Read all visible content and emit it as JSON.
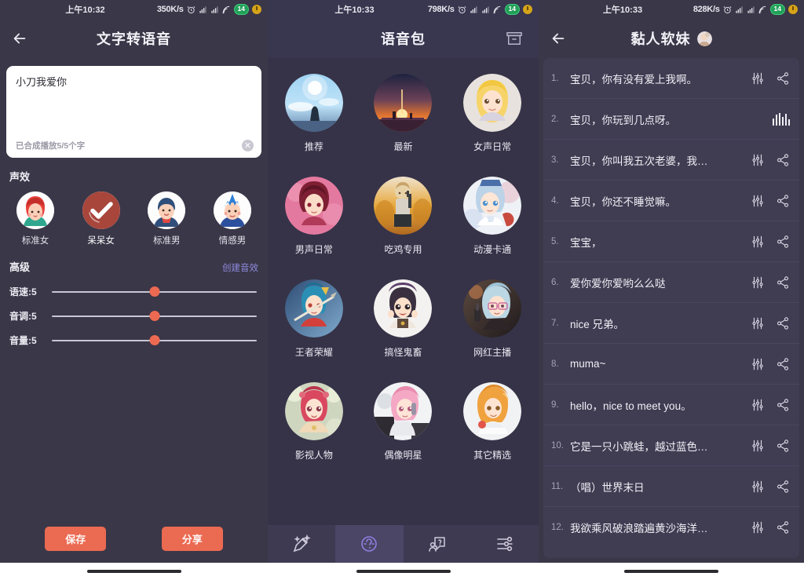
{
  "panel_tts": {
    "statusbar": {
      "time": "上午10:32",
      "speed": "350K/s",
      "battery": "14"
    },
    "title": "文字转语音",
    "back_icon": "back-arrow-icon",
    "editor": {
      "text": "小刀我爱你",
      "status": "已合成播放5/5个字",
      "clear_label": "✕"
    },
    "voice_section_label": "声效",
    "voices": [
      {
        "label": "标准女",
        "selected": false
      },
      {
        "label": "呆呆女",
        "selected": true
      },
      {
        "label": "标准男",
        "selected": false
      },
      {
        "label": "情感男",
        "selected": false
      }
    ],
    "advanced_label": "高级",
    "create_effect_link": "创建音效",
    "sliders": [
      {
        "label": "语速:5",
        "value": 5,
        "min": 0,
        "max": 10
      },
      {
        "label": "音调:5",
        "value": 5,
        "min": 0,
        "max": 10
      },
      {
        "label": "音量:5",
        "value": 5,
        "min": 0,
        "max": 10
      }
    ],
    "save_label": "保存",
    "share_label": "分享"
  },
  "panel_packs": {
    "statusbar": {
      "time": "上午10:33",
      "speed": "798K/s",
      "battery": "14"
    },
    "title": "语音包",
    "archive_icon": "archive-box-icon",
    "packs": [
      {
        "label": "推荐"
      },
      {
        "label": "最新"
      },
      {
        "label": "女声日常"
      },
      {
        "label": "男声日常"
      },
      {
        "label": "吃鸡专用"
      },
      {
        "label": "动漫卡通"
      },
      {
        "label": "王者荣耀"
      },
      {
        "label": "搞怪鬼畜"
      },
      {
        "label": "网红主播"
      },
      {
        "label": "影视人物"
      },
      {
        "label": "偶像明星"
      },
      {
        "label": "其它精选"
      }
    ],
    "tabs": [
      {
        "icon": "magic-wand-icon",
        "active": false
      },
      {
        "icon": "voice-pack-icon",
        "active": true
      },
      {
        "icon": "help-chat-icon",
        "active": false
      },
      {
        "icon": "settings-sliders-icon",
        "active": false
      }
    ]
  },
  "panel_phrases": {
    "statusbar": {
      "time": "上午10:33",
      "speed": "828K/s",
      "battery": "14"
    },
    "title": "黏人软妹",
    "avatar_icon": "profile-avatar",
    "back_icon": "back-arrow-icon",
    "items": [
      {
        "num": "1.",
        "text": "宝贝，你有没有爱上我啊。",
        "playing": false
      },
      {
        "num": "2.",
        "text": "宝贝，你玩到几点呀。",
        "playing": true
      },
      {
        "num": "3.",
        "text": "宝贝，你叫我五次老婆，我…",
        "playing": false
      },
      {
        "num": "4.",
        "text": "宝贝，你还不睡觉嘛。",
        "playing": false
      },
      {
        "num": "5.",
        "text": "宝宝，",
        "playing": false
      },
      {
        "num": "6.",
        "text": "爱你爱你爱哟么么哒",
        "playing": false
      },
      {
        "num": "7.",
        "text": "nice 兄弟。",
        "playing": false
      },
      {
        "num": "8.",
        "text": "muma~",
        "playing": false
      },
      {
        "num": "9.",
        "text": "hello，nice to meet you。",
        "playing": false
      },
      {
        "num": "10.",
        "text": "它是一只小跳蛙，越过蓝色…",
        "playing": false
      },
      {
        "num": "11.",
        "text": "（唱）世界末日",
        "playing": false
      },
      {
        "num": "12.",
        "text": "我欲乘风破浪踏遍黄沙海洋…",
        "playing": false
      }
    ],
    "row_icons": {
      "equalizer": "equalizer-icon",
      "share": "share-icon",
      "waveform": "waveform-playing-icon"
    }
  },
  "colors": {
    "background": "#3a3748",
    "panel_mid": "#393650",
    "accent": "#eb6a52",
    "link": "#8f8adf",
    "row": "#403c52",
    "tab_active": "#4b4566",
    "battery": "#23a05a"
  }
}
